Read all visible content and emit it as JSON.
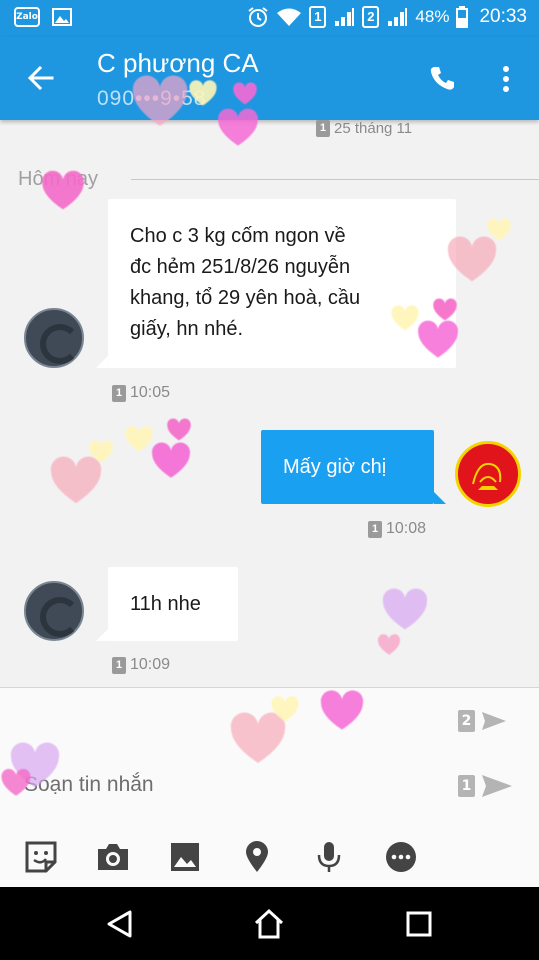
{
  "status_bar": {
    "sim1": "1",
    "sim2": "2",
    "battery": "48%",
    "time": "20:33",
    "notification_icons": [
      "zalo-icon",
      "gallery-icon"
    ],
    "zalo_label": "Zalo"
  },
  "header": {
    "contact_name": "C phương CA",
    "phone_number": "090•••9•58",
    "icons": [
      "back-arrow-icon",
      "phone-icon",
      "more-vert-icon"
    ]
  },
  "chat": {
    "previous_date": {
      "sim": "1",
      "text": "25 tháng 11"
    },
    "day_separator": "Hôm nay",
    "messages": [
      {
        "direction": "incoming",
        "lines": [
          "Cho c 3 kg cốm ngon về",
          "đc hẻm 251/8/26 nguyễn",
          "khang, tổ 29 yên hoà, cầu",
          "giấy, hn nhé."
        ],
        "sim": "1",
        "time": "10:05"
      },
      {
        "direction": "outgoing",
        "lines": [
          "Mấy giờ chị"
        ],
        "sim": "1",
        "time": "10:08"
      },
      {
        "direction": "incoming",
        "lines": [
          "11h nhe"
        ],
        "sim": "1",
        "time": "10:09"
      }
    ]
  },
  "composer": {
    "placeholder": "Soạn tin nhắn",
    "send_sim2": "2",
    "send_sim1": "1",
    "toolbar_icons": [
      "sticker-icon",
      "camera-icon",
      "image-icon",
      "location-icon",
      "microphone-icon",
      "more-options-icon"
    ]
  },
  "nav_bar": {
    "icons": [
      "back-triangle-icon",
      "home-icon",
      "recents-icon"
    ]
  },
  "colors": {
    "primary": "#1e97e0",
    "outgoing_bubble": "#1aa0f0",
    "incoming_bubble": "#ffffff",
    "background": "#f2f2f2"
  }
}
